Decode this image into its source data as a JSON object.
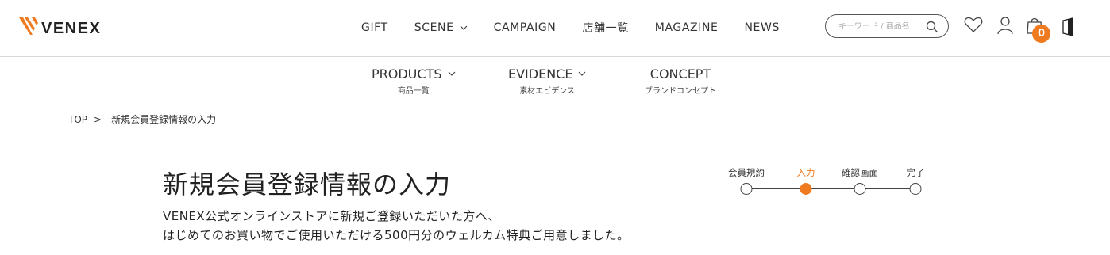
{
  "brand": {
    "name": "VENEX",
    "accent_color": "#ef7a20"
  },
  "header": {
    "nav": [
      {
        "label": "GIFT"
      },
      {
        "label": "SCENE"
      },
      {
        "label": "CAMPAIGN"
      },
      {
        "label": "店舗一覧"
      },
      {
        "label": "MAGAZINE"
      },
      {
        "label": "NEWS"
      }
    ],
    "search": {
      "placeholder": "キーワード / 商品名"
    },
    "icons": [
      "search-icon",
      "heart-icon",
      "user-icon",
      "cart-icon",
      "bookmark-icon"
    ],
    "cart_count": "0"
  },
  "subnav": [
    {
      "label": "PRODUCTS",
      "sub": "商品一覧"
    },
    {
      "label": "EVIDENCE",
      "sub": "素材エビデンス"
    },
    {
      "label": "CONCEPT",
      "sub": "ブランドコンセプト"
    }
  ],
  "breadcrumb": {
    "home": "TOP",
    "separator": ">",
    "current": "新規会員登録情報の入力"
  },
  "main": {
    "title": "新規会員登録情報の入力",
    "intro_line1": "VENEX公式オンラインストアに新規ご登録いただいた方へ、",
    "intro_line2": "はじめてのお買い物でご使用いただける500円分のウェルカム特典ご用意しました。"
  },
  "steps": [
    {
      "label": "会員規約"
    },
    {
      "label": "入力"
    },
    {
      "label": "確認画面"
    },
    {
      "label": "完了"
    }
  ],
  "steps_current": "入力"
}
